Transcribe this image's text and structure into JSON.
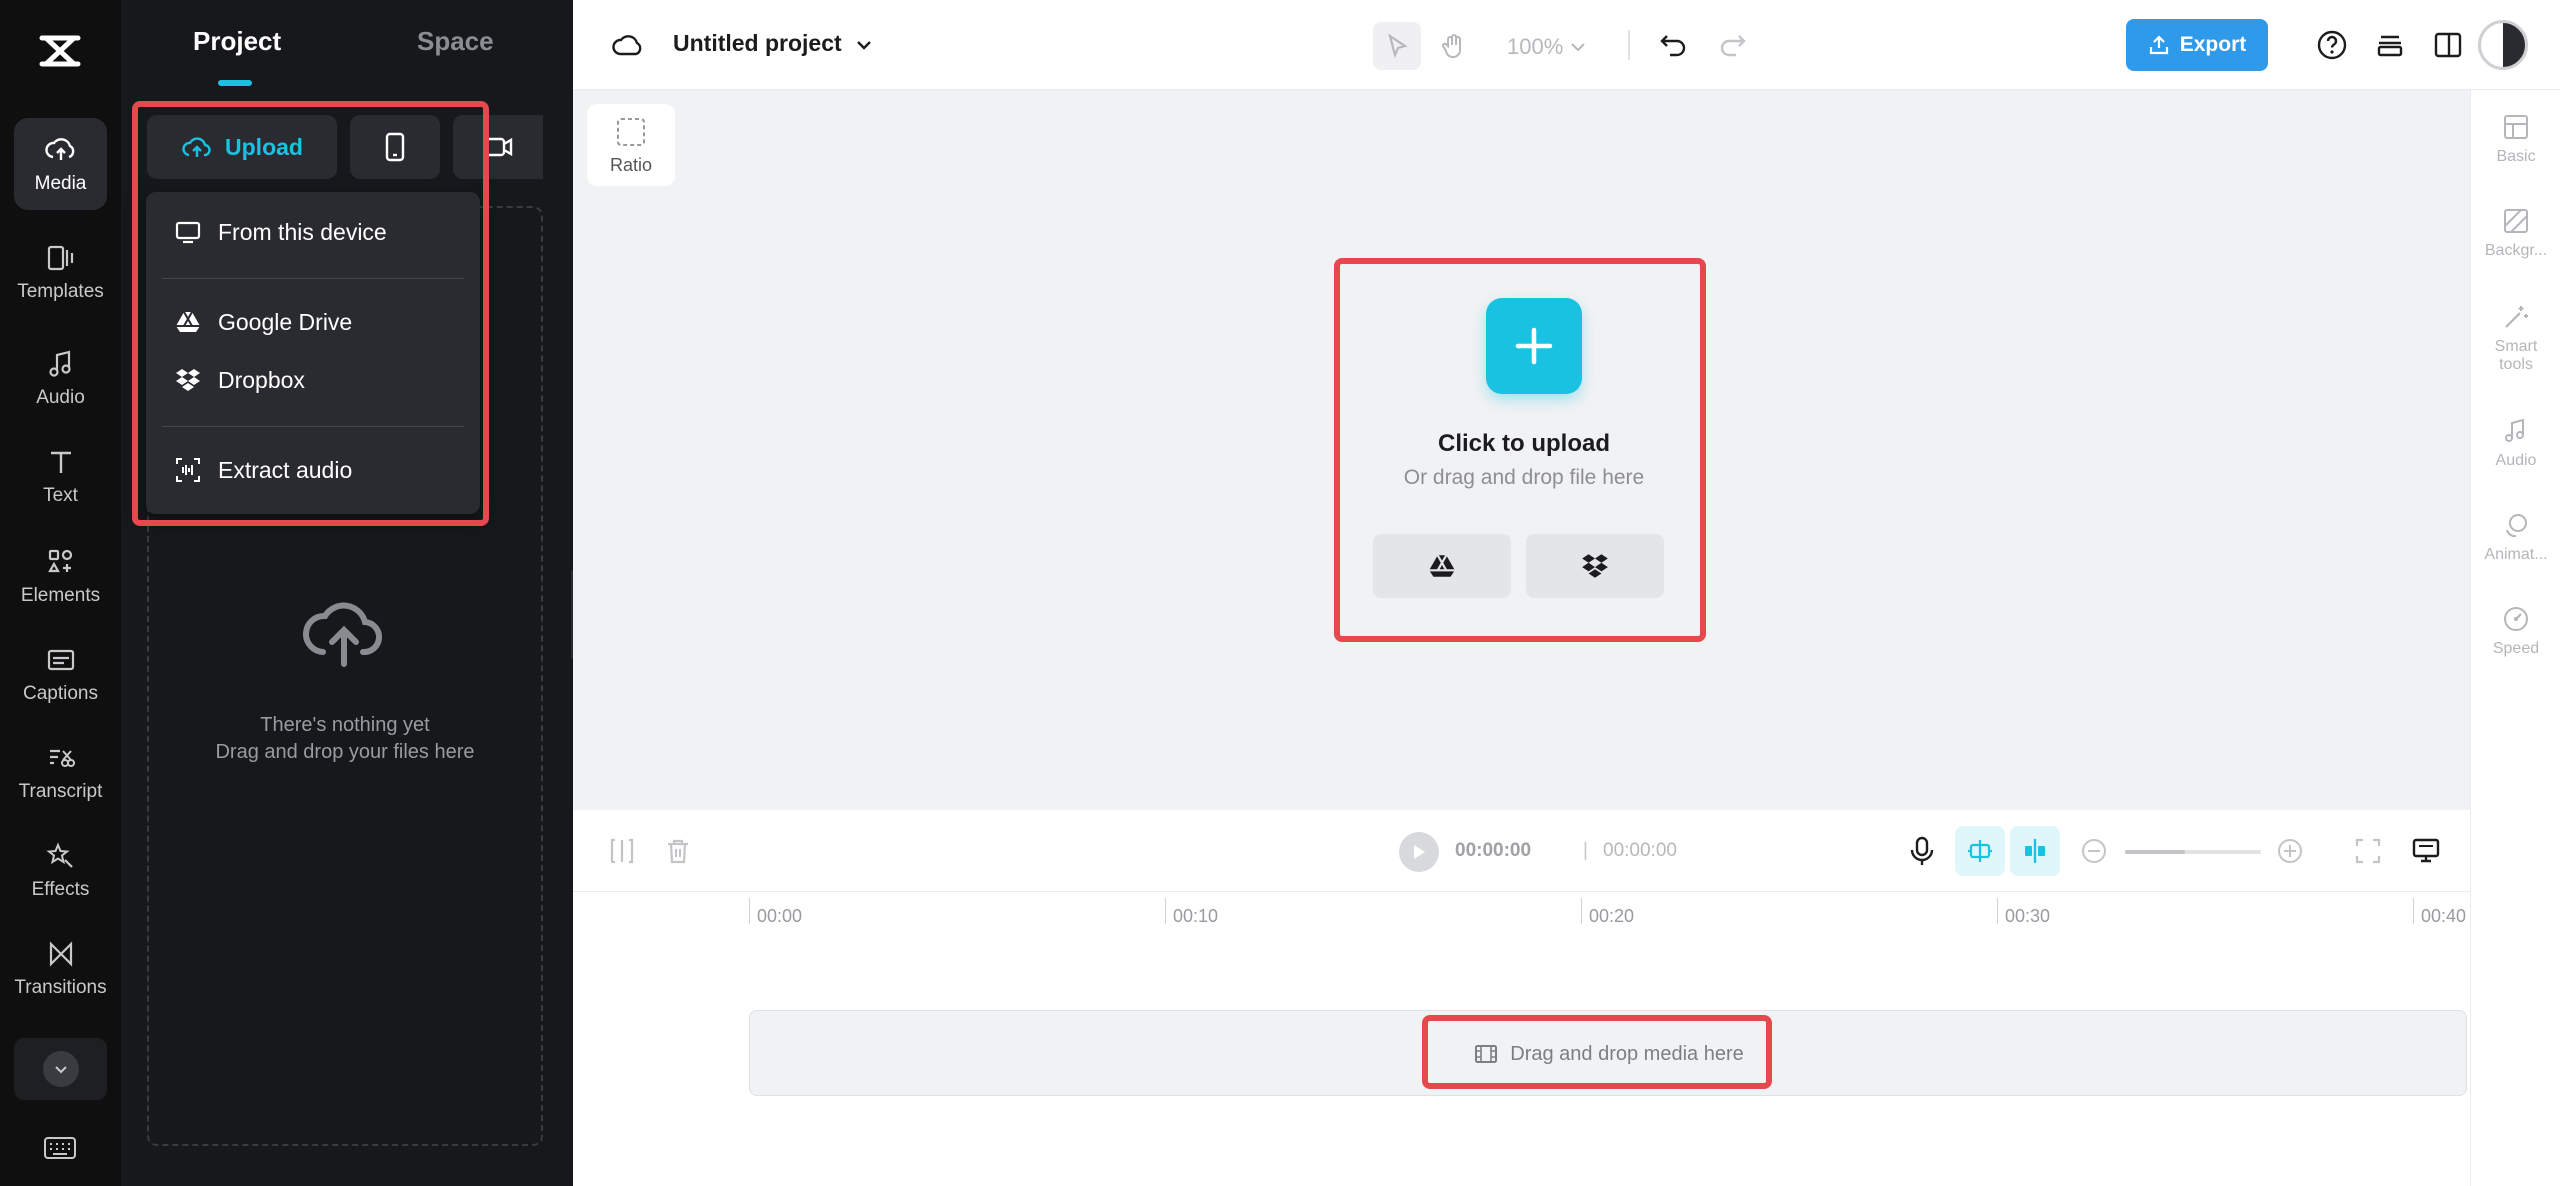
{
  "rail": {
    "items": [
      {
        "label": "Media",
        "icon": "cloud-upload-icon"
      },
      {
        "label": "Templates",
        "icon": "templates-icon"
      },
      {
        "label": "Audio",
        "icon": "music-note-icon"
      },
      {
        "label": "Text",
        "icon": "text-icon"
      },
      {
        "label": "Elements",
        "icon": "elements-icon"
      },
      {
        "label": "Captions",
        "icon": "captions-icon"
      },
      {
        "label": "Transcript",
        "icon": "transcript-icon"
      },
      {
        "label": "Effects",
        "icon": "effects-icon"
      },
      {
        "label": "Transitions",
        "icon": "transitions-icon"
      }
    ]
  },
  "panel": {
    "tabs": [
      {
        "label": "Project"
      },
      {
        "label": "Space"
      }
    ],
    "upload_label": "Upload",
    "dropdown": {
      "from_device": "From this device",
      "google_drive": "Google Drive",
      "dropbox": "Dropbox",
      "extract_audio": "Extract audio"
    },
    "empty_line1": "There's nothing yet",
    "empty_line2": "Drag and drop your files here"
  },
  "topbar": {
    "project_title": "Untitled project",
    "zoom": "100%",
    "export_label": "Export"
  },
  "canvas": {
    "ratio_label": "Ratio",
    "upload_title": "Click to upload",
    "upload_sub": "Or drag and drop file here"
  },
  "right_sidebar": {
    "items": [
      {
        "label": "Basic"
      },
      {
        "label": "Backgr..."
      },
      {
        "label": "Smart tools"
      },
      {
        "label": "Audio"
      },
      {
        "label": "Animat..."
      },
      {
        "label": "Speed"
      }
    ]
  },
  "timeline": {
    "current_time": "00:00:00",
    "separator": "|",
    "total_time": "00:00:00",
    "ticks": [
      "00:00",
      "00:10",
      "00:20",
      "00:30",
      "00:40"
    ],
    "track_label": "Drag and drop media here"
  },
  "colors": {
    "accent": "#19c2e0",
    "export": "#2f9ae9",
    "highlight": "#e5484d"
  }
}
